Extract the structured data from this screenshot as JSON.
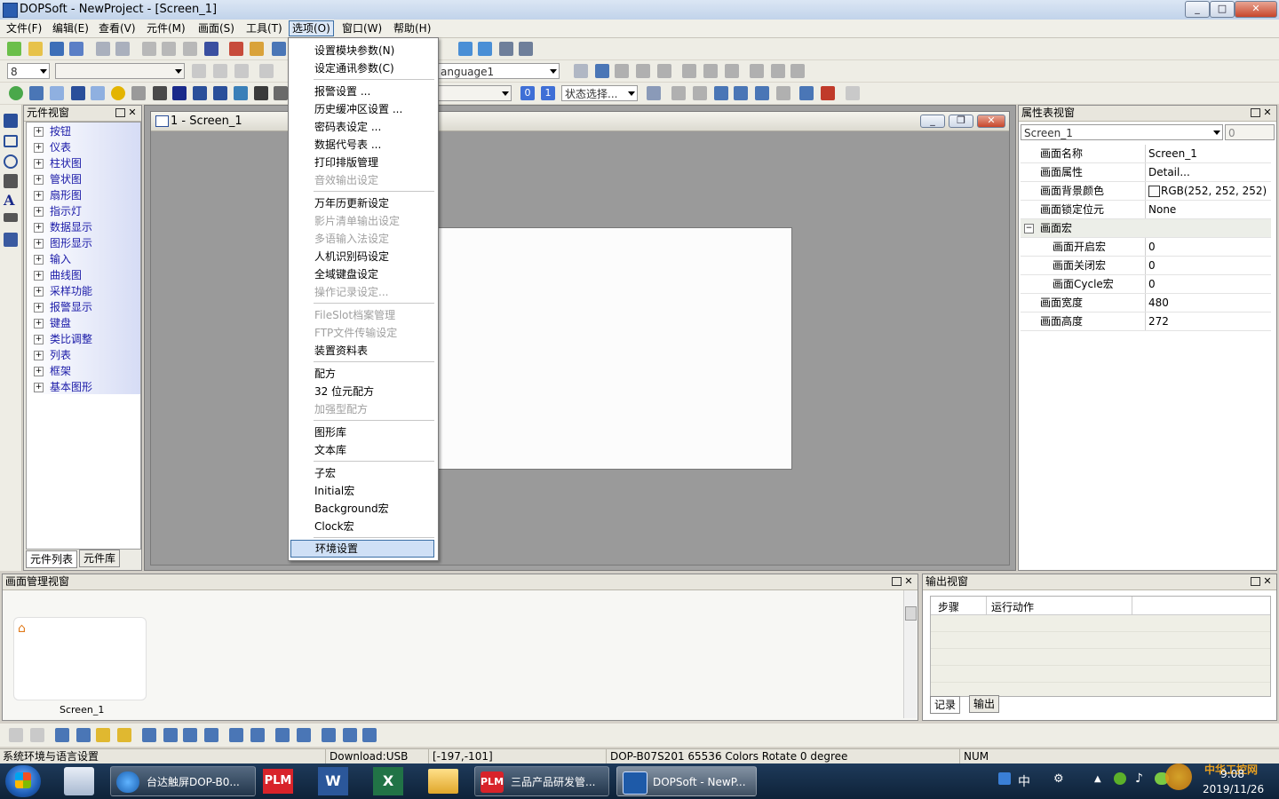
{
  "window": {
    "title": "DOPSoft - NewProject - [Screen_1]",
    "min": "_",
    "max": "□",
    "close": "✕"
  },
  "menubar": [
    "文件(F)",
    "编辑(E)",
    "查看(V)",
    "元件(M)",
    "画面(S)",
    "工具(T)",
    "选项(O)",
    "窗口(W)",
    "帮助(H)"
  ],
  "toolbar": {
    "font_size": "8",
    "language": "anguage1",
    "state_select": "状态选择...",
    "badge0": "0",
    "badge1": "1"
  },
  "options_menu": {
    "items": [
      "设置模块参数(N)",
      "设定通讯参数(C)",
      "报警设置 ...",
      "历史缓冲区设置 ...",
      "密码表设定 ...",
      "数据代号表 ...",
      "打印排版管理",
      "音效输出设定",
      "万年历更新设定",
      "影片清单输出设定",
      "多语输入法设定",
      "人机识别码设定",
      "全域键盘设定",
      "操作记录设定...",
      "FileSlot档案管理",
      "FTP文件传输设定",
      "装置资料表",
      "配方",
      "32 位元配方",
      "加强型配方",
      "图形库",
      "文本库",
      "子宏",
      "Initial宏",
      "Background宏",
      "Clock宏",
      "环境设置"
    ]
  },
  "component_panel": {
    "title": "元件视窗",
    "items": [
      "按钮",
      "仪表",
      "柱状图",
      "管状图",
      "扇形图",
      "指示灯",
      "数据显示",
      "图形显示",
      "输入",
      "曲线图",
      "采样功能",
      "报警显示",
      "键盘",
      "类比调整",
      "列表",
      "框架",
      "基本图形"
    ],
    "tabs": [
      "元件列表",
      "元件库"
    ]
  },
  "screen_window": {
    "title": "1 - Screen_1"
  },
  "property_panel": {
    "title": "属性表视窗",
    "selector": "Screen_1",
    "spin": "0",
    "rows": [
      {
        "k": "画面名称",
        "v": "Screen_1"
      },
      {
        "k": "画面属性",
        "v": "Detail..."
      },
      {
        "k": "画面背景颜色",
        "v": "RGB(252, 252, 252)"
      },
      {
        "k": "画面锁定位元",
        "v": "None"
      },
      {
        "k": "画面宏",
        "v": ""
      },
      {
        "k": "画面开启宏",
        "v": "0"
      },
      {
        "k": "画面关闭宏",
        "v": "0"
      },
      {
        "k": "画面Cycle宏",
        "v": "0"
      },
      {
        "k": "画面宽度",
        "v": "480"
      },
      {
        "k": "画面高度",
        "v": "272"
      }
    ]
  },
  "screen_manager": {
    "title": "画面管理视窗",
    "thumb_label": "Screen_1"
  },
  "output_panel": {
    "title": "输出视窗",
    "col1": "步骤",
    "col2": "运行动作",
    "tabs": [
      "记录",
      "输出"
    ]
  },
  "statusbar": {
    "hint": "系统环境与语言设置",
    "download": "Download:USB",
    "coords": "[-197,-101]",
    "device": "DOP-B07S201 65536 Colors Rotate 0 degree",
    "num": "NUM"
  },
  "taskbar": {
    "tasks": [
      "台达触屏DOP-B0...",
      "PLM",
      "三品产品研发管...",
      "DOPSoft - NewP..."
    ],
    "ime": "中",
    "time": "9:08",
    "date": "2019/11/26",
    "watermark": "中华工控网"
  },
  "colors": {
    "accent": "#3a6ea5",
    "tree_text": "#1a1aa8",
    "canvas_bg": "#9a9a9a"
  }
}
